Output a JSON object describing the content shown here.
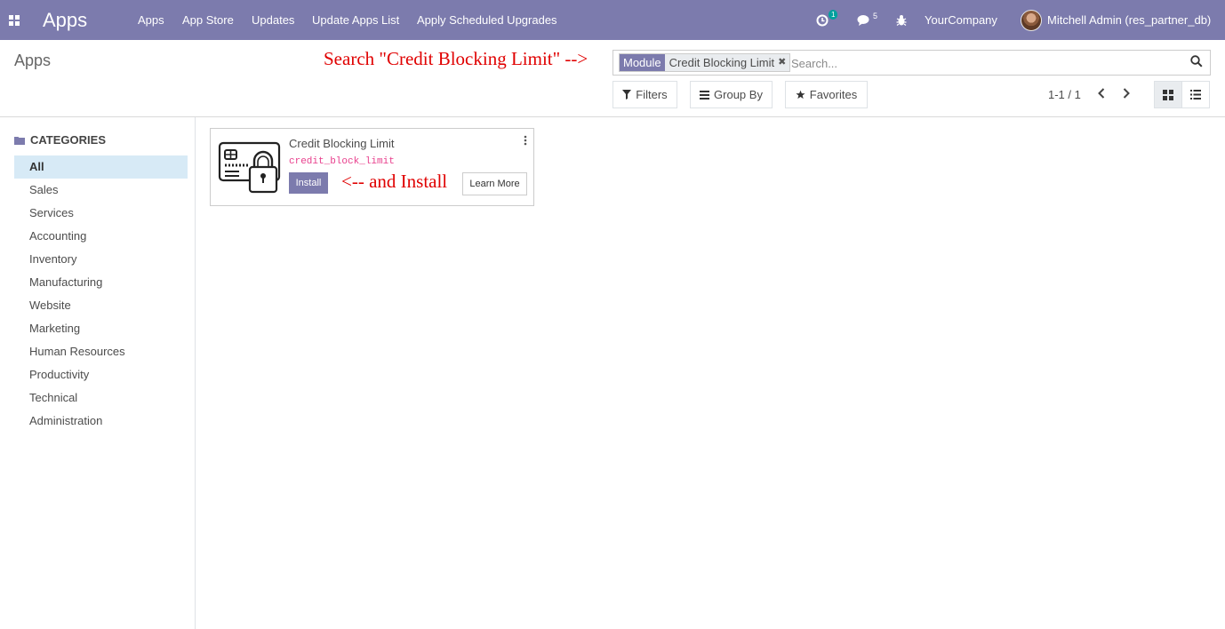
{
  "navbar": {
    "brand": "Apps",
    "menu": [
      "Apps",
      "App Store",
      "Updates",
      "Update Apps List",
      "Apply Scheduled Upgrades"
    ],
    "activity_count": "1",
    "messages_count": "5",
    "company": "YourCompany",
    "user": "Mitchell Admin (res_partner_db)",
    "icons": [
      "apps-grid-icon",
      "clock-icon",
      "chat-icon",
      "bug-icon",
      "avatar"
    ]
  },
  "control_panel": {
    "title": "Apps",
    "annotation_search": "Search \"Credit Blocking Limit\" -->",
    "facet_label": "Module",
    "facet_value": "Credit Blocking Limit",
    "search_placeholder": "Search...",
    "filters_label": "Filters",
    "groupby_label": "Group By",
    "favorites_label": "Favorites",
    "pager_value": "1-1 / 1"
  },
  "sidebar": {
    "header": "CATEGORIES",
    "categories": [
      "All",
      "Sales",
      "Services",
      "Accounting",
      "Inventory",
      "Manufacturing",
      "Website",
      "Marketing",
      "Human Resources",
      "Productivity",
      "Technical",
      "Administration"
    ],
    "active": "All"
  },
  "card": {
    "name": "Credit Blocking Limit",
    "technical_name": "credit_block_limit",
    "install_label": "Install",
    "learn_more_label": "Learn More",
    "annotation_install": "<-- and Install"
  },
  "colors": {
    "navbar": "#7c7bad",
    "accent": "#7c7bad",
    "badge": "#00a09d",
    "annotation": "#e00000",
    "active_category": "#d7eaf6"
  }
}
